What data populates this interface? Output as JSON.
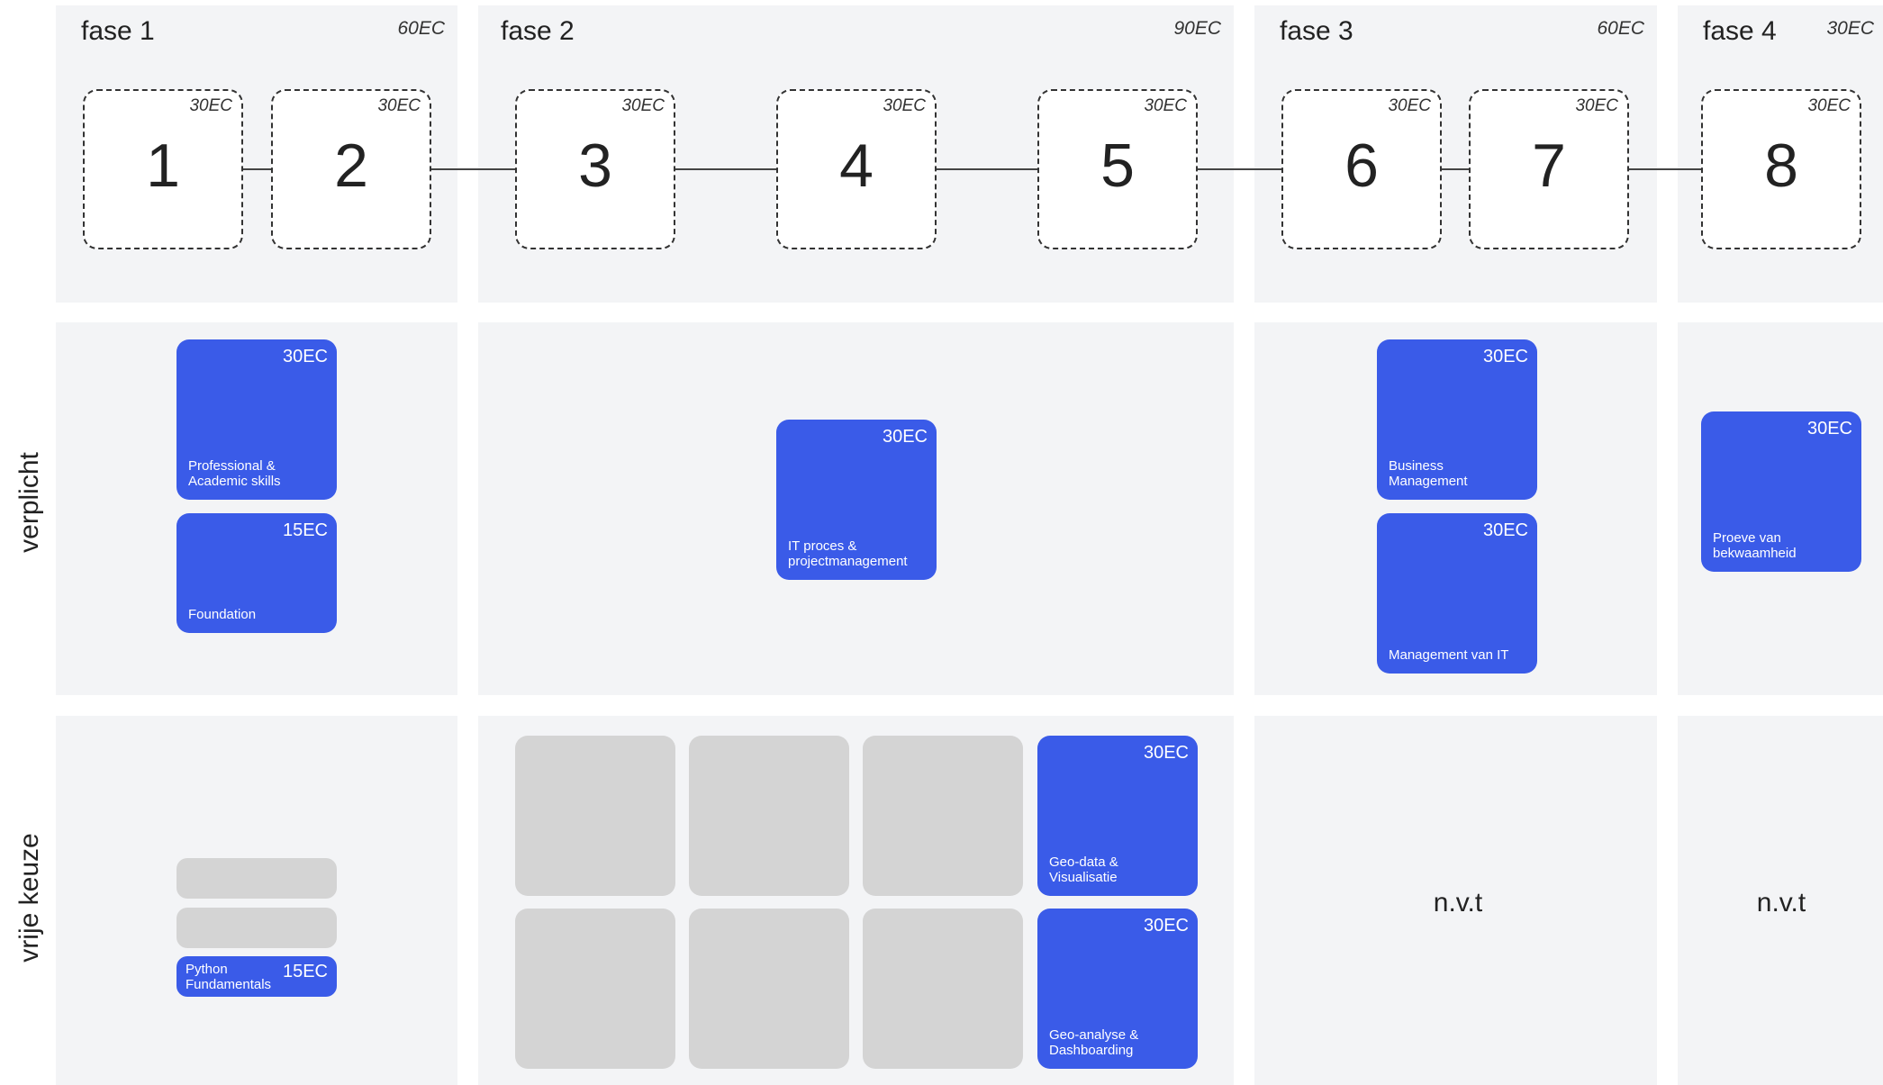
{
  "phases": [
    {
      "title": "fase 1",
      "ec": "60EC"
    },
    {
      "title": "fase 2",
      "ec": "90EC"
    },
    {
      "title": "fase 3",
      "ec": "60EC"
    },
    {
      "title": "fase 4",
      "ec": "30EC"
    }
  ],
  "semesters": [
    {
      "num": "1",
      "ec": "30EC"
    },
    {
      "num": "2",
      "ec": "30EC"
    },
    {
      "num": "3",
      "ec": "30EC"
    },
    {
      "num": "4",
      "ec": "30EC"
    },
    {
      "num": "5",
      "ec": "30EC"
    },
    {
      "num": "6",
      "ec": "30EC"
    },
    {
      "num": "7",
      "ec": "30EC"
    },
    {
      "num": "8",
      "ec": "30EC"
    }
  ],
  "rows": {
    "mandatory": "verplicht",
    "elective": "vrije keuze"
  },
  "mandatory_courses": [
    {
      "name": "Professional &\nAcademic skills",
      "ec": "30EC"
    },
    {
      "name": "Foundation",
      "ec": "15EC"
    },
    {
      "name": "IT proces &\nprojectmanagement",
      "ec": "30EC"
    },
    {
      "name": "Business\nManagement",
      "ec": "30EC"
    },
    {
      "name": "Management van IT",
      "ec": "30EC"
    },
    {
      "name": "Proeve van\nbekwaamheid",
      "ec": "30EC"
    }
  ],
  "elective_courses": [
    {
      "name": "Python\nFundamentals",
      "ec": "15EC"
    },
    {
      "name": "Geo-data &\nVisualisatie",
      "ec": "30EC"
    },
    {
      "name": "Geo-analyse &\nDashboarding",
      "ec": "30EC"
    }
  ],
  "not_applicable": [
    "n.v.t",
    "n.v.t"
  ],
  "colors": {
    "course": "#3a5be8",
    "panel": "#f3f4f6",
    "placeholder": "#d4d4d4"
  }
}
